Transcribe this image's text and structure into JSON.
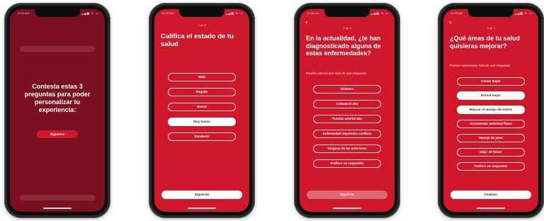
{
  "status": {
    "time": "10:00 AM",
    "icons": "▂▄▆ ≋ ▭"
  },
  "phone1": {
    "intro": "Contesta estas 3 preguntas para poder personalizar tu experiencia:",
    "button": "Siguiente"
  },
  "phone2": {
    "step": "1 de 3",
    "title": "Califica el estado de tu salud",
    "options": [
      {
        "label": "Mala",
        "selected": false
      },
      {
        "label": "Regular",
        "selected": false
      },
      {
        "label": "Buena",
        "selected": false
      },
      {
        "label": "Muy buena",
        "selected": true
      },
      {
        "label": "Excelente",
        "selected": false
      }
    ],
    "button": "Siguiente"
  },
  "phone3": {
    "step": "2 de 3",
    "title": "En la actualidad, ¿te han diagnosticado alguna de estas enfermedades?",
    "subtitle": "Puedes seleccionar más de una respuesta.",
    "options": [
      {
        "label": "Diabetes",
        "selected": false
      },
      {
        "label": "Colesterol alto",
        "selected": false
      },
      {
        "label": "Presión arterial alta",
        "selected": false
      },
      {
        "label": "Enfermedad isquémica cardiaca",
        "selected": false
      },
      {
        "label": "Ninguna de las anteriores",
        "selected": false
      },
      {
        "label": "Prefiero no responder",
        "selected": false
      }
    ],
    "button": "Siguiente"
  },
  "phone4": {
    "step": "3 de 3",
    "title": "¿Qué áreas de tu salud quisieras mejorar?",
    "subtitle": "Puedes seleccionar más de una respuesta.",
    "options": [
      {
        "label": "Comer mejor",
        "selected": false
      },
      {
        "label": "Dormir mejor",
        "selected": true
      },
      {
        "label": "Mejorar el manejo del estrés",
        "selected": true
      },
      {
        "label": "Incrementar actividad física",
        "selected": false
      },
      {
        "label": "Manejo de peso",
        "selected": false
      },
      {
        "label": "Dejar de fumar",
        "selected": false
      },
      {
        "label": "Prefiero no responder",
        "selected": false
      }
    ],
    "button": "Finalizar"
  },
  "colors": {
    "brand_red": "#d0182c",
    "dark_overlay": "#7a1020",
    "device": "#2b2b2d"
  }
}
